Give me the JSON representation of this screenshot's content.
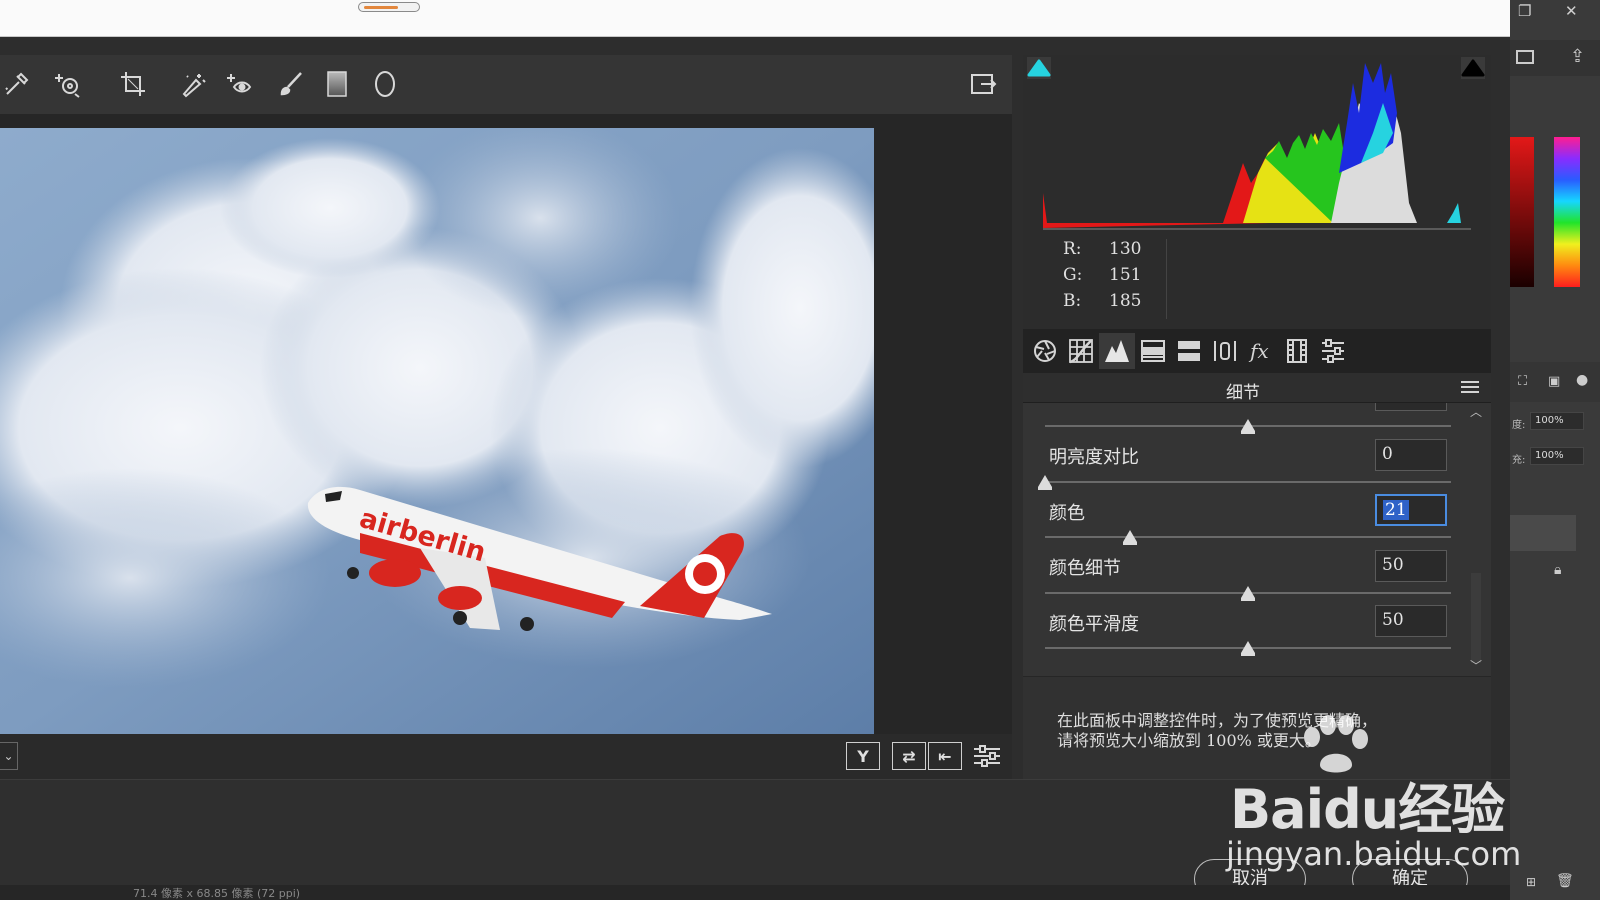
{
  "histogram": {
    "r": 130,
    "g": 151,
    "b": 185,
    "r_label": "R:",
    "g_label": "G:",
    "b_label": "B:"
  },
  "panel": {
    "title": "细节",
    "sliders": [
      {
        "label": "明亮度对比",
        "value": "0",
        "position": 0.0
      },
      {
        "label": "颜色",
        "value": "21",
        "position": 0.21
      },
      {
        "label": "颜色细节",
        "value": "50",
        "position": 0.5
      },
      {
        "label": "颜色平滑度",
        "value": "50",
        "position": 0.5
      }
    ],
    "hidden_slider_position": 0.5,
    "note_line1": "在此面板中调整控件时，为了使预览更精确，",
    "note_line2": "请将预览大小缩放到 100% 或更大。"
  },
  "photo": {
    "airline_text": "airberlin"
  },
  "buttons": {
    "cancel": "取消",
    "ok": "确定"
  },
  "ps_panel": {
    "pct1": "100%",
    "pct2": "100%",
    "lbl1": "度:",
    "lbl2": "充:"
  },
  "watermark": {
    "brand": "Baidu经验",
    "site": "jingyan.baidu.com"
  },
  "status": "71.4 像素 x 68.85 像素 (72 ppi)",
  "icons": [
    "eyedropper-icon",
    "target-adjust-icon",
    "crop-icon",
    "spot-removal-icon",
    "redeye-icon",
    "brush-icon",
    "gradient-icon",
    "radial-filter-icon",
    "open-preferences-icon"
  ]
}
